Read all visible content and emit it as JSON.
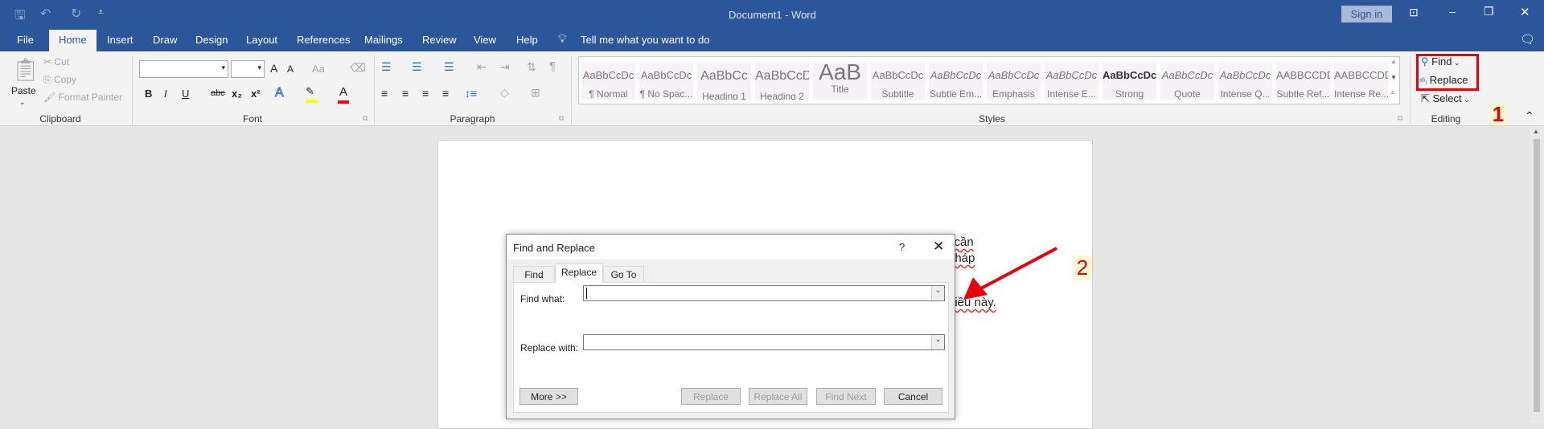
{
  "titlebar": {
    "title": "Document1  -  Word",
    "sign_in": "Sign in"
  },
  "tabs": [
    "File",
    "Home",
    "Insert",
    "Draw",
    "Design",
    "Layout",
    "References",
    "Mailings",
    "Review",
    "View",
    "Help"
  ],
  "tell_me": "Tell me what you want to do",
  "clipboard": {
    "paste": "Paste",
    "cut": "Cut",
    "copy": "Copy",
    "format_painter": "Format Painter",
    "label": "Clipboard"
  },
  "font": {
    "label": "Font",
    "bold": "B",
    "italic": "I",
    "underline": "U",
    "strike": "abc",
    "sub": "x₂",
    "sup": "x²",
    "grow": "A",
    "shrink": "A",
    "case": "Aa",
    "effects": "A",
    "color": "A",
    "highlight_color": "#ffff00",
    "font_color": "#ff0000"
  },
  "paragraph": {
    "label": "Paragraph",
    "pilcrow": "¶"
  },
  "styles": {
    "label": "Styles",
    "items": [
      {
        "preview": "AaBbCcDc",
        "name": "¶ Normal"
      },
      {
        "preview": "AaBbCcDc",
        "name": "¶ No Spac..."
      },
      {
        "preview": "AaBbCc",
        "name": "Heading 1"
      },
      {
        "preview": "AaBbCcD",
        "name": "Heading 2"
      },
      {
        "preview": "AaB",
        "name": "Title"
      },
      {
        "preview": "AaBbCcDc",
        "name": "Subtitle"
      },
      {
        "preview": "AaBbCcDc",
        "name": "Subtle Em..."
      },
      {
        "preview": "AaBbCcDc",
        "name": "Emphasis"
      },
      {
        "preview": "AaBbCcDc",
        "name": "Intense E..."
      },
      {
        "preview": "AaBbCcDc",
        "name": "Strong"
      },
      {
        "preview": "AaBbCcDc",
        "name": "Quote"
      },
      {
        "preview": "AaBbCcDc",
        "name": "Intense Q..."
      },
      {
        "preview": "AABBCCDD",
        "name": "Subtle Ref..."
      },
      {
        "preview": "AABBCCDD",
        "name": "Intense Re..."
      }
    ]
  },
  "editing": {
    "find": "Find",
    "replace": "Replace",
    "select": "Select",
    "label": "Editing"
  },
  "annotations": {
    "step1": "1",
    "step2": "2",
    "highlight_color": "#e8000b"
  },
  "document": {
    "lines": [
      "g cần",
      "pháp",
      "điều này."
    ]
  },
  "dialog": {
    "title": "Find and Replace",
    "help": "?",
    "tabs": [
      "Find",
      "Replace",
      "Go To"
    ],
    "find_label": "Find what:",
    "find_value": "",
    "replace_label": "Replace with:",
    "replace_value": "",
    "buttons": {
      "more": "More >>",
      "replace": "Replace",
      "replace_all": "Replace All",
      "find_next": "Find Next",
      "cancel": "Cancel"
    }
  }
}
